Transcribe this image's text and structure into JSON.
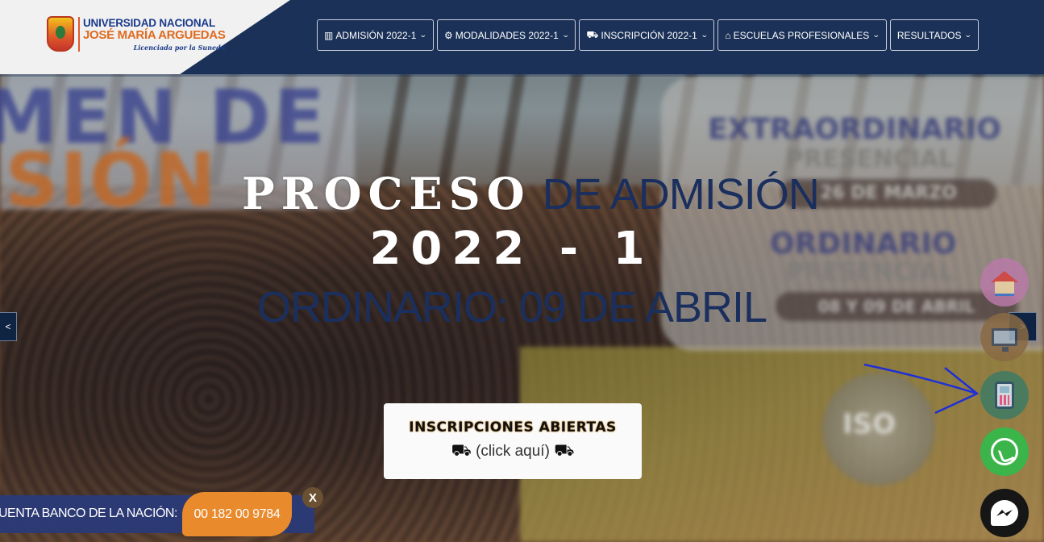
{
  "header": {
    "logo": {
      "line1": "UNIVERSIDAD NACIONAL",
      "line2": "JOSÉ MARÍA ARGUEDAS",
      "tagline": "Licenciada por la Sunedu"
    },
    "nav": [
      {
        "label": "ADMISIÓN 2022-1",
        "icon": "building-icon",
        "glyph": "▥"
      },
      {
        "label": "MODALIDADES 2022-1",
        "icon": "modalities-icon",
        "glyph": "⚙"
      },
      {
        "label": "INSCRIPCIÓN 2022-1",
        "icon": "person-desk-icon",
        "glyph": "⛟"
      },
      {
        "label": "ESCUELAS PROFESIONALES",
        "icon": "institution-icon",
        "glyph": "⌂"
      },
      {
        "label": "RESULTADOS",
        "icon": "",
        "glyph": ""
      }
    ]
  },
  "hero": {
    "background_texts": {
      "examen": "MEN DE",
      "admision": "ISIÓN",
      "extraordinario": "EXTRAORDINARIO",
      "presencial_1": "PRESENCIAL",
      "date_1": "26 DE MARZO",
      "ordinario": "ORDINARIO",
      "presencial_2": "PRESENCIAL",
      "date_2": "08 Y 09 DE ABRIL",
      "iso": "ISO"
    },
    "headline_white": "PROCESO",
    "headline_blue": " DE ADMISIÓN",
    "year": "2022 - 1",
    "date_line": "ORDINARIO: 09 DE ABRIL",
    "prev_label": "<",
    "next_label": ">"
  },
  "cta": {
    "title": "INSCRIPCIONES ABIERTAS",
    "link": "(click aquí)",
    "icon_glyph": "⛟"
  },
  "bank": {
    "label": "UENTA BANCO DE LA NACIÓN:",
    "number": "00 182 00 9784",
    "close": "X"
  },
  "colors": {
    "header_bg": "#1b3157",
    "accent_orange": "#e98a2d",
    "headline_blue": "#1b2f5e",
    "whatsapp_green": "#3bb54a",
    "annotation_blue": "#1f2fd6"
  }
}
